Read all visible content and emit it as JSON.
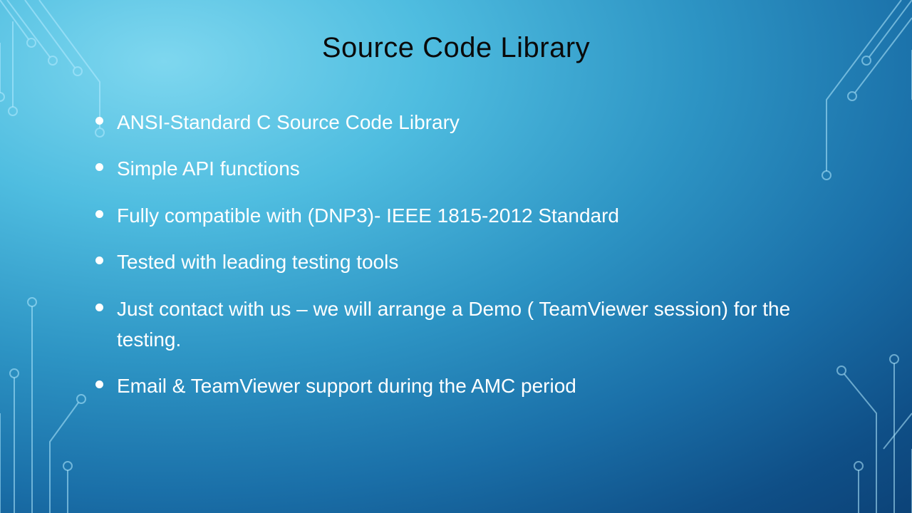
{
  "title": "Source Code Library",
  "bullets": [
    "ANSI-Standard C Source Code Library",
    "Simple API functions",
    "Fully compatible with (DNP3)- IEEE 1815-2012 Standard",
    "Tested with leading testing tools",
    "Just contact with us – we will arrange a Demo ( TeamViewer session) for the testing.",
    "Email & TeamViewer support during the AMC period"
  ]
}
